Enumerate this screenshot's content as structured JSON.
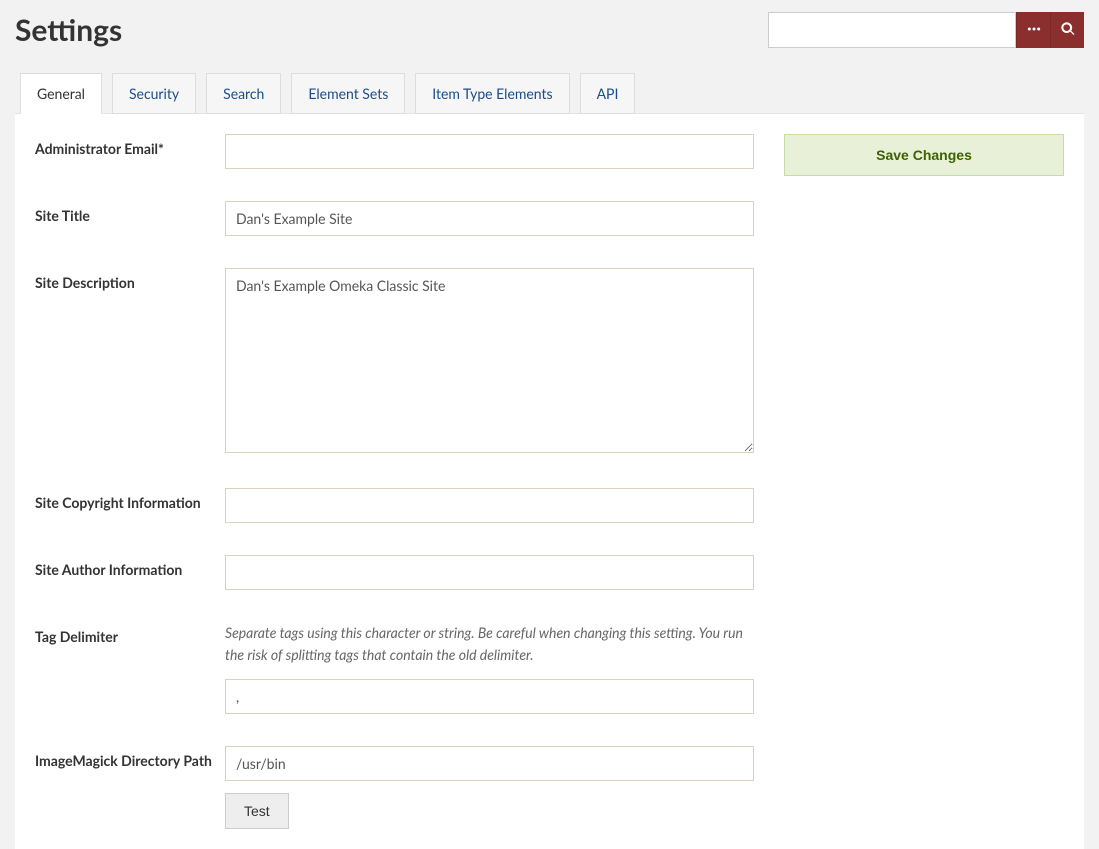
{
  "page_title": "Settings",
  "search": {
    "value": "",
    "placeholder": ""
  },
  "tabs": [
    {
      "label": "General",
      "active": true
    },
    {
      "label": "Security",
      "active": false
    },
    {
      "label": "Search",
      "active": false
    },
    {
      "label": "Element Sets",
      "active": false
    },
    {
      "label": "Item Type Elements",
      "active": false
    },
    {
      "label": "API",
      "active": false
    }
  ],
  "fields": {
    "admin_email": {
      "label": "Administrator Email*",
      "value": ""
    },
    "site_title": {
      "label": "Site Title",
      "value": "Dan's Example Site"
    },
    "site_description": {
      "label": "Site Description",
      "value": "Dan's Example Omeka Classic Site"
    },
    "site_copyright": {
      "label": "Site Copyright Information",
      "value": ""
    },
    "site_author": {
      "label": "Site Author Information",
      "value": ""
    },
    "tag_delimiter": {
      "label": "Tag Delimiter",
      "explanation": "Separate tags using this character or string. Be careful when changing this setting. You run the risk of splitting tags that contain the old delimiter.",
      "value": ","
    },
    "imagemagick": {
      "label": "ImageMagick Directory Path",
      "value": "/usr/bin",
      "test_label": "Test"
    }
  },
  "save_label": "Save Changes"
}
